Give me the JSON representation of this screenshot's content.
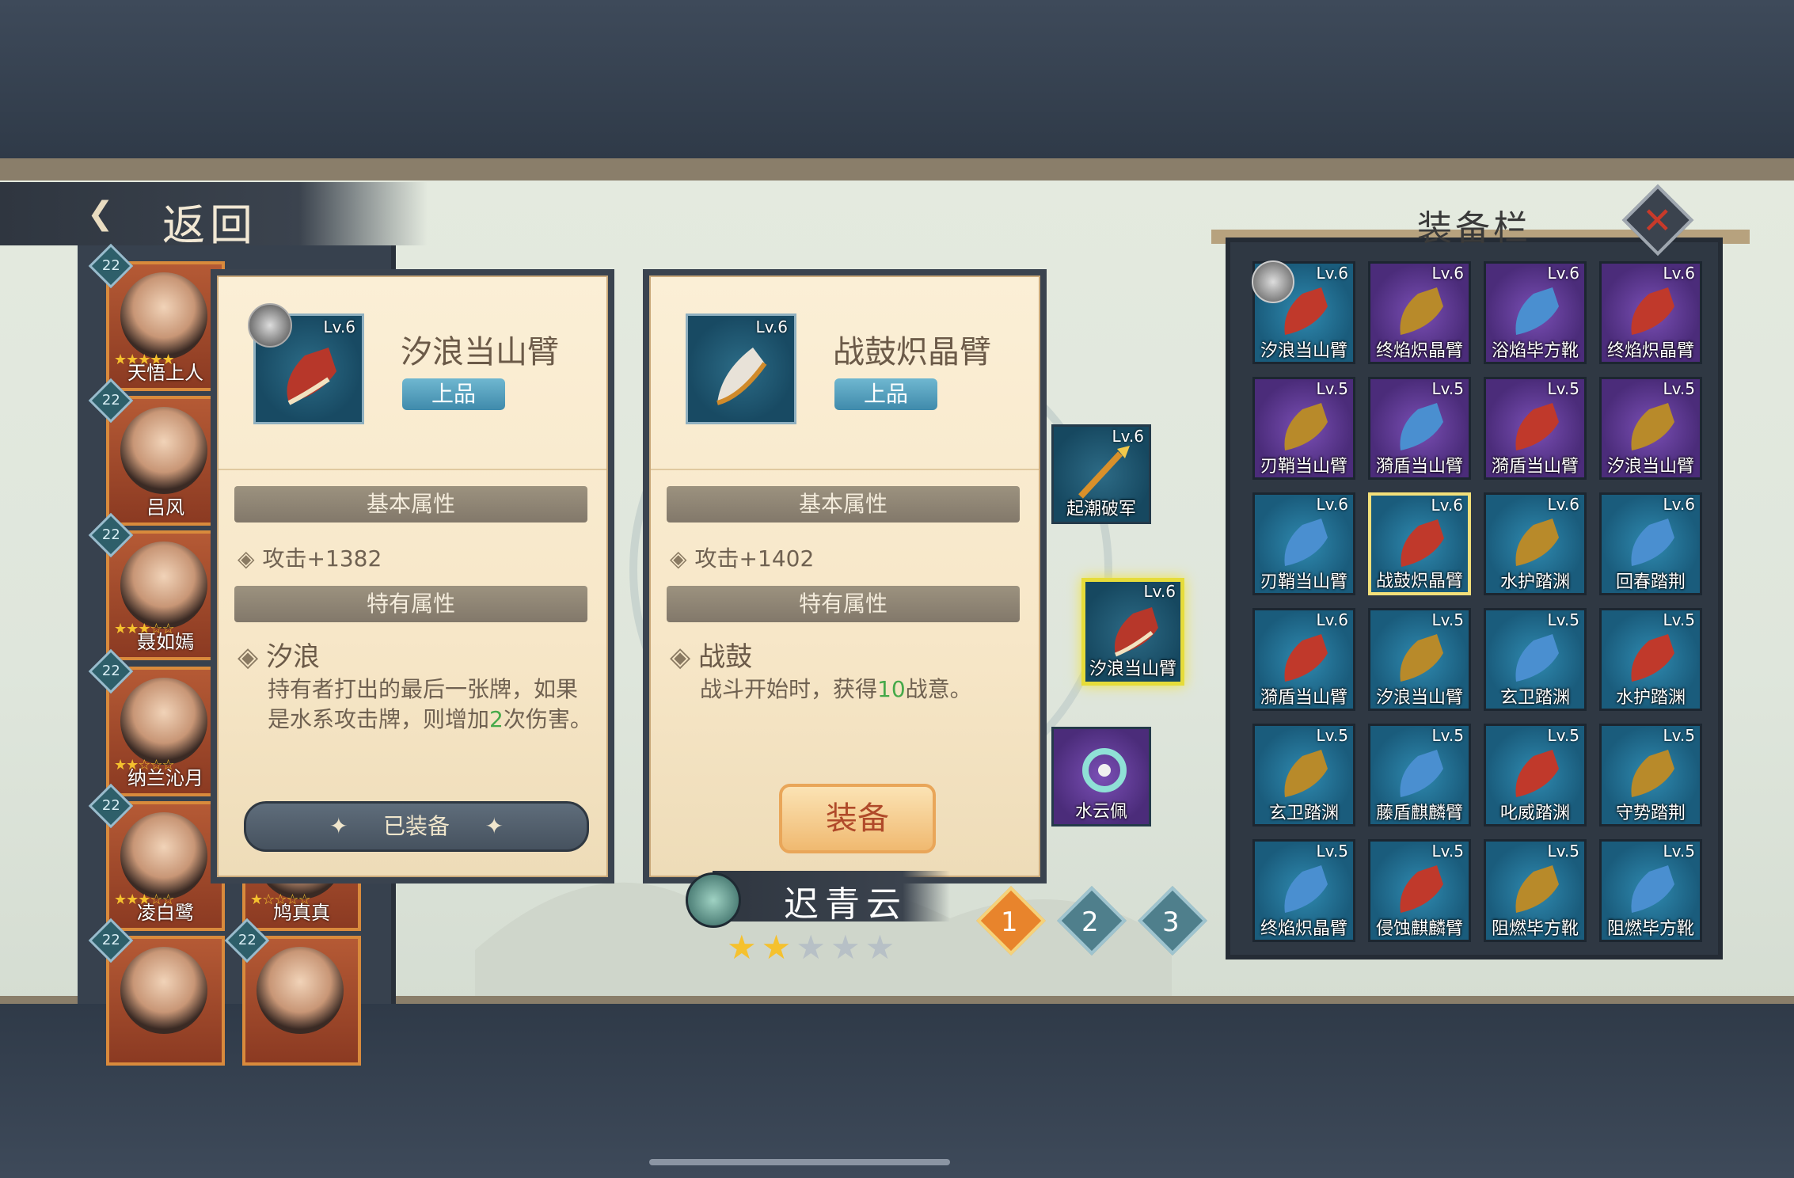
{
  "nav": {
    "back_label": "返回"
  },
  "roster": [
    {
      "level": "22",
      "name": "天悟上人",
      "stars": "★★★★★"
    },
    {
      "level": "22",
      "name": "吕风",
      "stars": ""
    },
    {
      "level": "22",
      "name": "聂如嫣",
      "stars": "★★★☆☆"
    },
    {
      "level": "22",
      "name": "纳兰沁月",
      "stars": "★★☆☆☆"
    },
    {
      "level": "22",
      "name": "凌白鹭",
      "stars": "★★★☆☆"
    },
    {
      "level": "22",
      "name": "鸠真真",
      "stars": "★☆☆☆☆"
    },
    {
      "level": "22",
      "name": "",
      "stars": ""
    },
    {
      "level": "22",
      "name": "",
      "stars": ""
    }
  ],
  "left_panel": {
    "level": "Lv.6",
    "title": "汐浪当山臂",
    "grade": "上品",
    "basic_header": "基本属性",
    "basic_attr": "攻击+1382",
    "special_header": "特有属性",
    "special_name": "汐浪",
    "desc_a": "持有者打出的最后一张牌，如果是水系攻击牌，则增加",
    "desc_num": "2",
    "desc_b": "次伤害。",
    "button": "已装备"
  },
  "right_panel": {
    "level": "Lv.6",
    "title": "战鼓炽晶臂",
    "grade": "上品",
    "basic_header": "基本属性",
    "basic_attr": "攻击+1402",
    "special_header": "特有属性",
    "special_name": "战鼓",
    "desc_a": "战斗开始时，获得",
    "desc_num": "10",
    "desc_b": "战意。",
    "button": "装备"
  },
  "hero_slots": [
    {
      "level": "Lv.6",
      "name": "起潮破军"
    },
    {
      "level": "Lv.6",
      "name": "汐浪当山臂"
    },
    {
      "level": "",
      "name": "水云佩"
    }
  ],
  "hero": {
    "name": "迟青云",
    "stars_on": "★★",
    "stars_off": "★★★"
  },
  "pages": [
    "1",
    "2",
    "3"
  ],
  "inventory": {
    "title": "装备栏",
    "close": "✕",
    "items": [
      {
        "level": "Lv.6",
        "name": "汐浪当山臂",
        "color": "blue"
      },
      {
        "level": "Lv.6",
        "name": "终焰炽晶臂",
        "color": "purple"
      },
      {
        "level": "Lv.6",
        "name": "浴焰毕方靴",
        "color": "purple"
      },
      {
        "level": "Lv.6",
        "name": "终焰炽晶臂",
        "color": "purple"
      },
      {
        "level": "Lv.5",
        "name": "刃鞘当山臂",
        "color": "purple"
      },
      {
        "level": "Lv.5",
        "name": "漪盾当山臂",
        "color": "purple"
      },
      {
        "level": "Lv.5",
        "name": "漪盾当山臂",
        "color": "purple"
      },
      {
        "level": "Lv.5",
        "name": "汐浪当山臂",
        "color": "purple"
      },
      {
        "level": "Lv.6",
        "name": "刃鞘当山臂",
        "color": "blue"
      },
      {
        "level": "Lv.6",
        "name": "战鼓炽晶臂",
        "color": "blue"
      },
      {
        "level": "Lv.6",
        "name": "水护踏渊",
        "color": "blue"
      },
      {
        "level": "Lv.6",
        "name": "回春踏荆",
        "color": "blue"
      },
      {
        "level": "Lv.6",
        "name": "漪盾当山臂",
        "color": "blue"
      },
      {
        "level": "Lv.5",
        "name": "汐浪当山臂",
        "color": "blue"
      },
      {
        "level": "Lv.5",
        "name": "玄卫踏渊",
        "color": "blue"
      },
      {
        "level": "Lv.5",
        "name": "水护踏渊",
        "color": "blue"
      },
      {
        "level": "Lv.5",
        "name": "玄卫踏渊",
        "color": "blue"
      },
      {
        "level": "Lv.5",
        "name": "藤盾麒麟臂",
        "color": "blue"
      },
      {
        "level": "Lv.5",
        "name": "叱威踏渊",
        "color": "blue"
      },
      {
        "level": "Lv.5",
        "name": "守势踏荆",
        "color": "blue"
      },
      {
        "level": "Lv.5",
        "name": "终焰炽晶臂",
        "color": "blue"
      },
      {
        "level": "Lv.5",
        "name": "侵蚀麒麟臂",
        "color": "blue"
      },
      {
        "level": "Lv.5",
        "name": "阻燃毕方靴",
        "color": "blue"
      },
      {
        "level": "Lv.5",
        "name": "阻燃毕方靴",
        "color": "blue"
      }
    ]
  },
  "colors": {
    "selected_border": "#f3e07a",
    "active_page": "#e8842c",
    "inactive_page": "#4f7f8c"
  }
}
